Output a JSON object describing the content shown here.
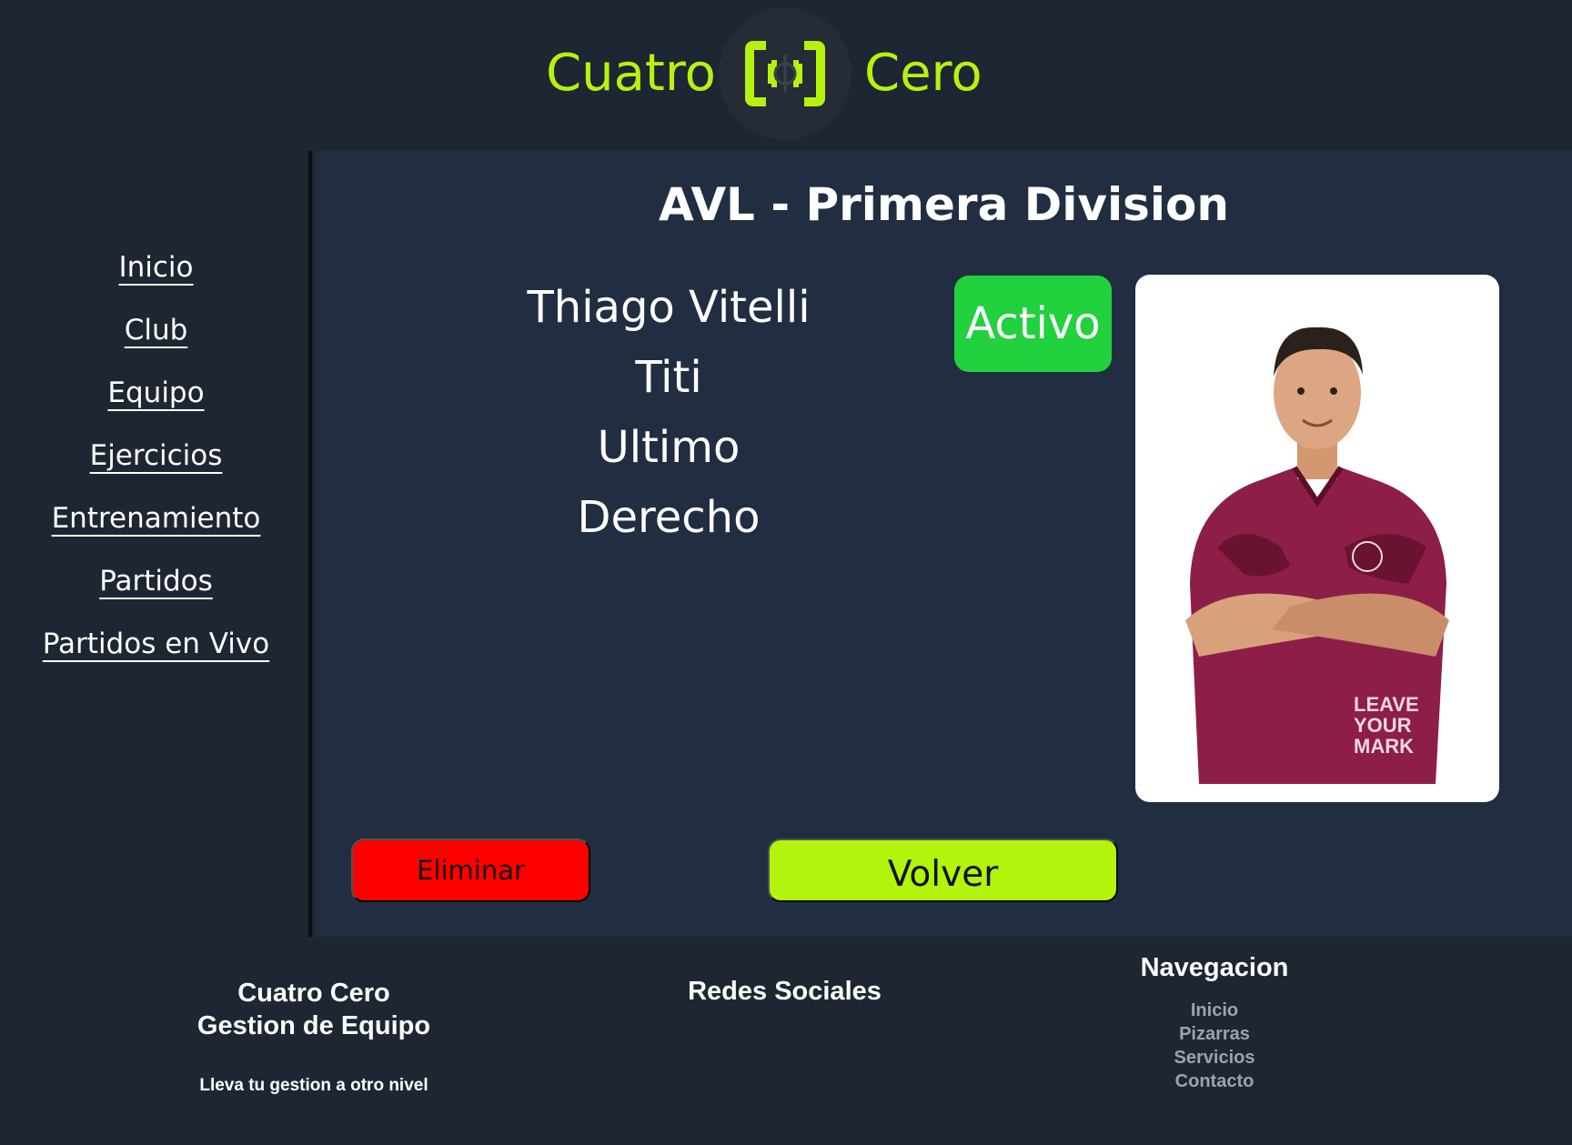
{
  "header": {
    "brand_left": "Cuatro",
    "brand_right": "Cero",
    "logo_icon": "bracket-ball-logo-icon",
    "accent_color": "#b5f20f"
  },
  "sidebar": {
    "items": [
      {
        "label": "Inicio"
      },
      {
        "label": "Club"
      },
      {
        "label": "Equipo"
      },
      {
        "label": "Ejercicios"
      },
      {
        "label": "Entrenamiento"
      },
      {
        "label": "Partidos"
      },
      {
        "label": "Partidos en Vivo"
      }
    ]
  },
  "main": {
    "team_title": "AVL - Primera Division",
    "player": {
      "name": "Thiago Vitelli",
      "nickname": "Titi",
      "position": "Ultimo",
      "foot": "Derecho",
      "status": "Activo",
      "status_color": "#22d13e"
    },
    "photo_alt": "player-photo",
    "actions": {
      "delete_label": "Eliminar",
      "delete_color": "#ff0000",
      "back_label": "Volver",
      "back_color": "#b2f40c"
    }
  },
  "footer": {
    "brand_line1": "Cuatro Cero",
    "brand_line2": "Gestion de Equipo",
    "tagline": "Lleva tu gestion a otro nivel",
    "social_title": "Redes Sociales",
    "nav_title": "Navegacion",
    "nav_links": [
      "Inicio",
      "Pizarras",
      "Servicios",
      "Contacto"
    ]
  }
}
